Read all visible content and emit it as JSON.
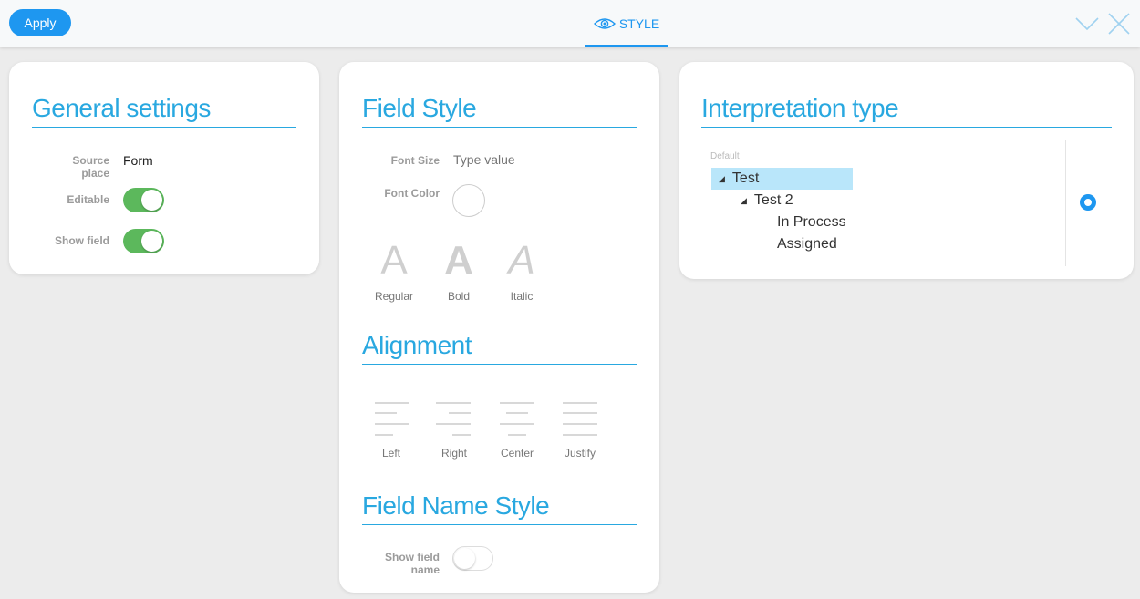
{
  "toolbar": {
    "apply_label": "Apply",
    "style_tab_label": "STYLE",
    "accent_color": "#1e97f0"
  },
  "general": {
    "title": "General settings",
    "source_place_label": "Source place",
    "source_place_value": "Form",
    "editable_label": "Editable",
    "editable_on": true,
    "show_field_label": "Show field",
    "show_field_on": true
  },
  "field_style": {
    "title": "Field Style",
    "font_size_label": "Font Size",
    "font_size_placeholder": "Type value",
    "font_color_label": "Font Color",
    "font_glyph": "A",
    "font_options": [
      "Regular",
      "Bold",
      "Italic"
    ],
    "alignment_title": "Alignment",
    "alignment_options": [
      "Left",
      "Right",
      "Center",
      "Justify"
    ],
    "field_name_title": "Field Name Style",
    "show_field_name_label": "Show field name",
    "show_field_name_on": false
  },
  "interpretation": {
    "title": "Interpretation type",
    "default_label": "Default",
    "tree": {
      "root": "Test",
      "child": "Test 2",
      "leaves": [
        "In Process",
        "Assigned"
      ]
    },
    "selected_highlight": "#b9e6fa"
  }
}
